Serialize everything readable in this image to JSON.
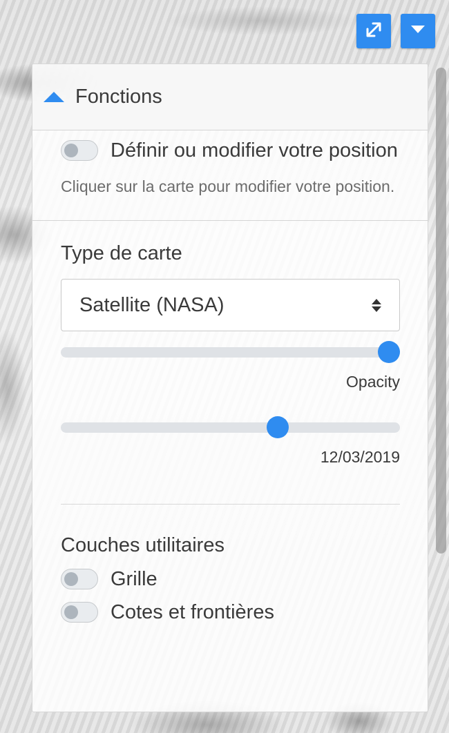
{
  "map_controls": {
    "expand_icon": "expand-arrows-icon",
    "dropdown_icon": "caret-down-icon"
  },
  "panel": {
    "header": {
      "title": "Fonctions",
      "icon": "caret-up-icon"
    },
    "position": {
      "toggle_label": "Définir ou modifier votre position",
      "toggle_on": false,
      "hint": "Cliquer sur la carte pour modifier votre position."
    },
    "map_type": {
      "label": "Type de carte",
      "selected": "Satellite (NASA)",
      "opacity_value": 1.0,
      "opacity_label": "Opacity",
      "date_value": 0.65,
      "date_label": "12/03/2019"
    },
    "layers": {
      "title": "Couches utilitaires",
      "items": [
        {
          "label": "Grille",
          "on": false
        },
        {
          "label": "Cotes et frontières",
          "on": false
        }
      ]
    }
  },
  "colors": {
    "accent": "#2f8cf0",
    "toggle_off_knob": "#adb5bd",
    "track": "#dfe2e6"
  }
}
